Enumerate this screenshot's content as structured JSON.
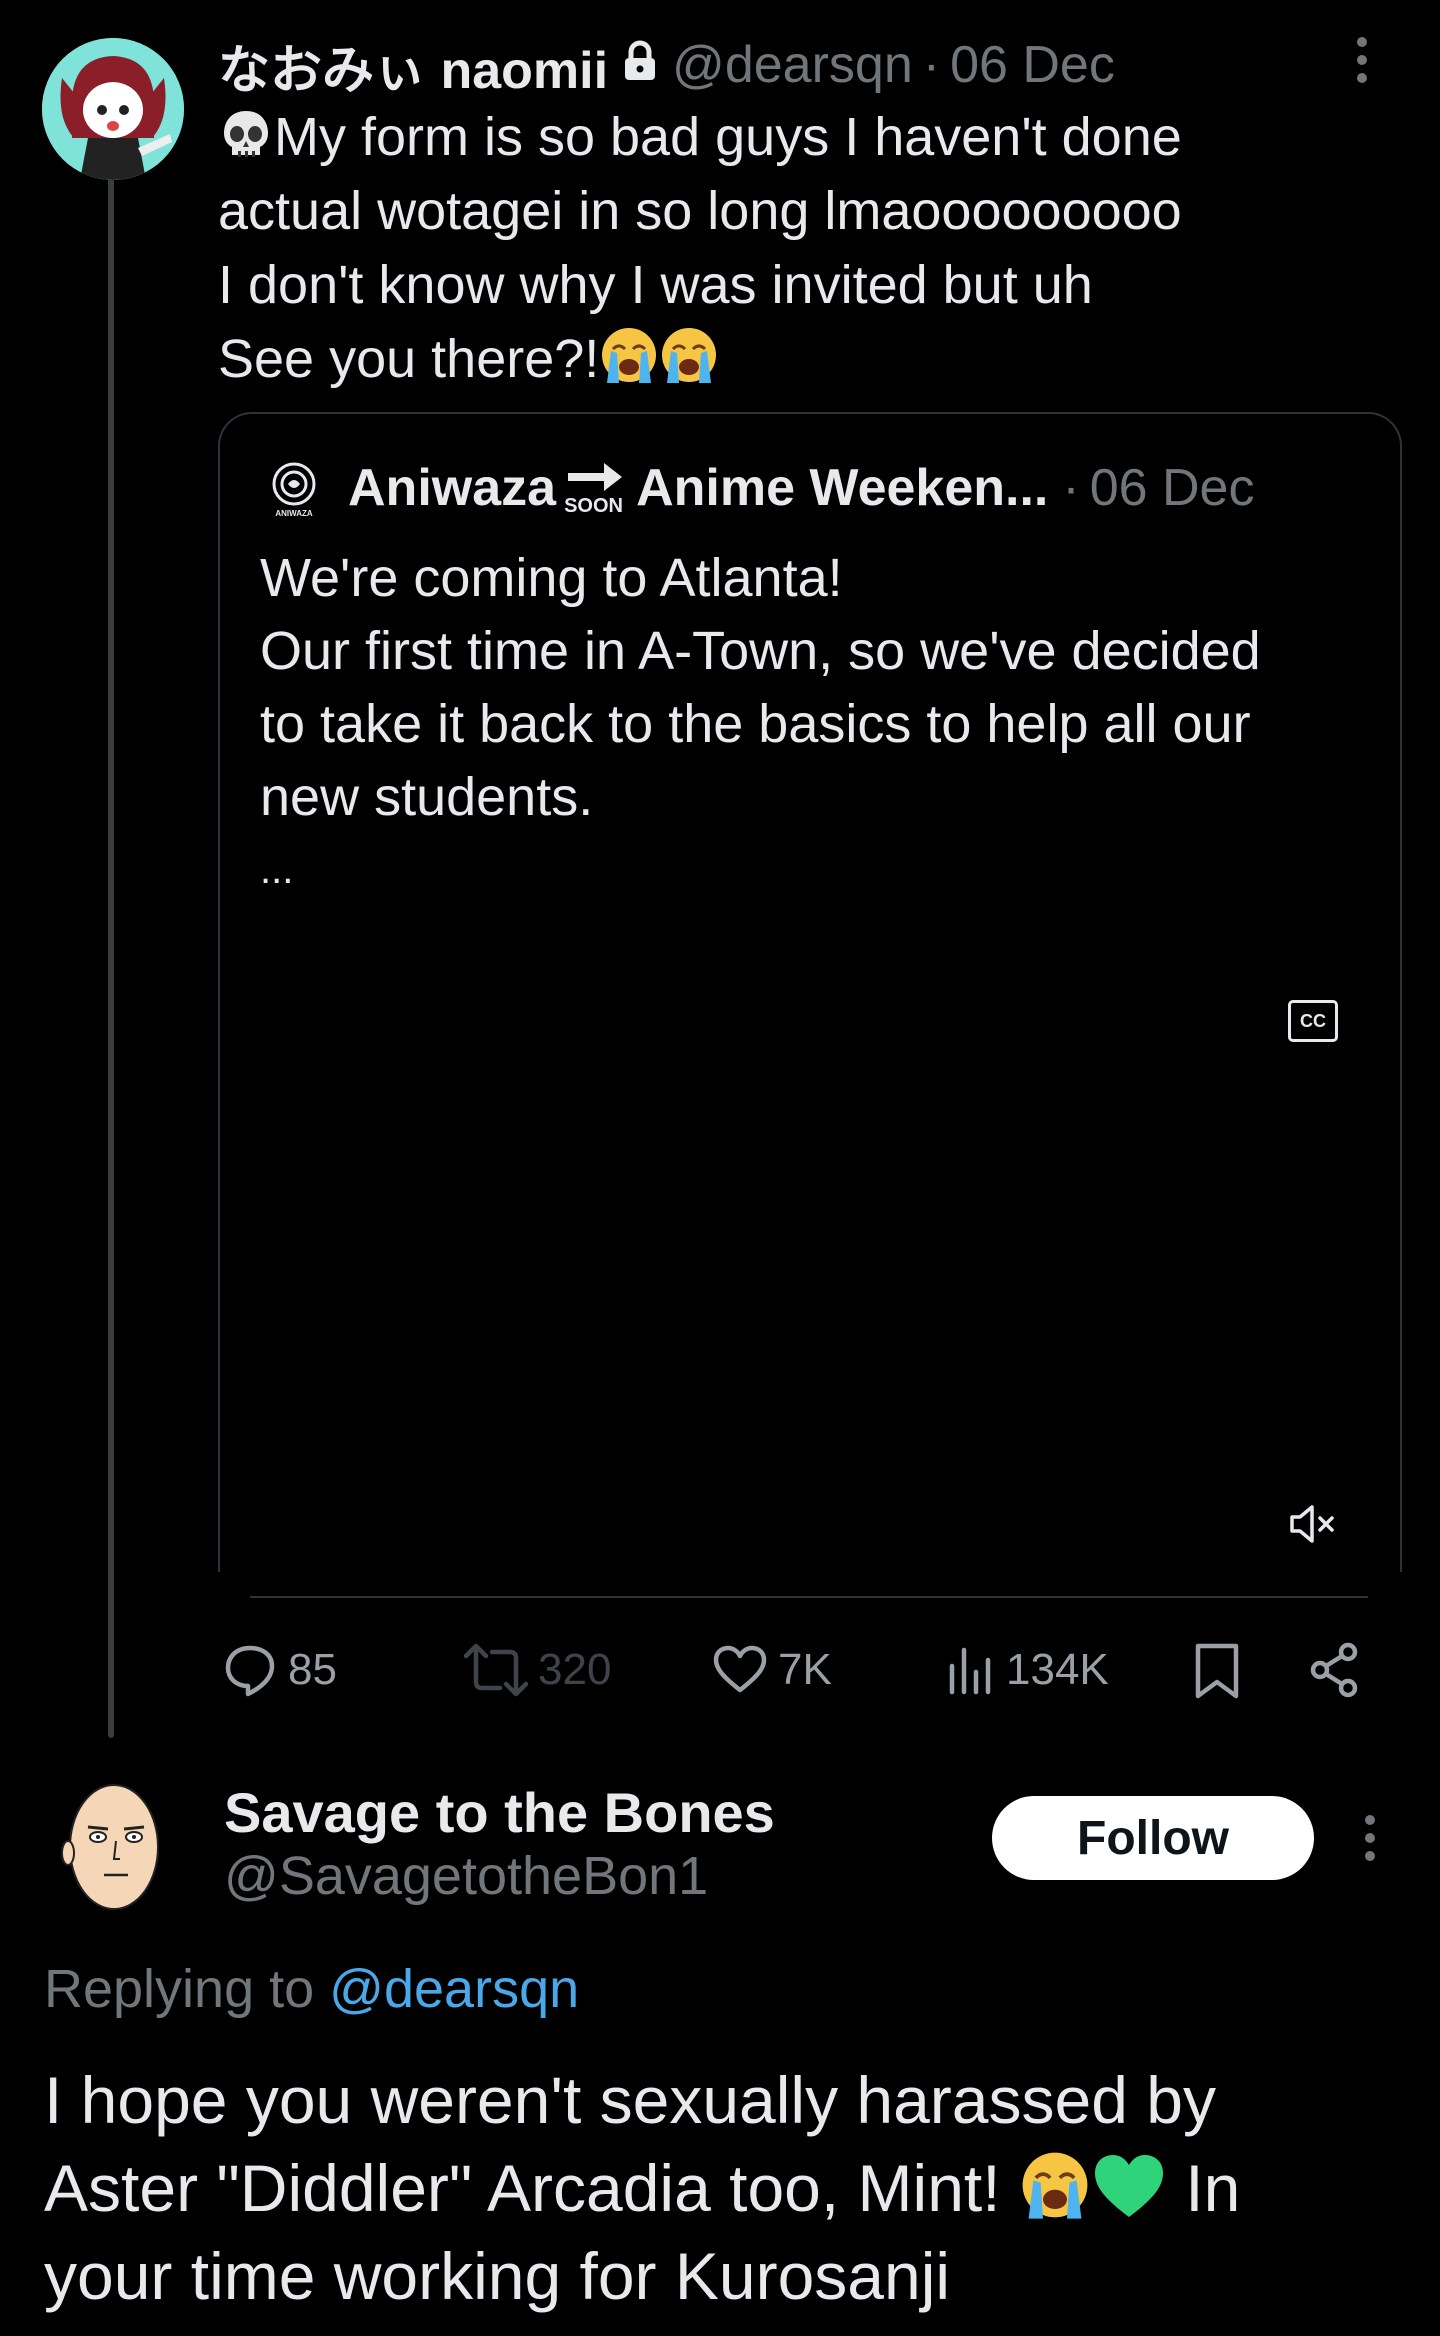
{
  "tweet": {
    "display_name": "なおみぃ naomii",
    "handle": "@dearsqn",
    "separator": "·",
    "date": "06 Dec",
    "text_lines": [
      "My form is so bad guys I haven't done",
      "actual wotagei in so long lmaooooooooo",
      "I don't know why I was invited but uh",
      "See you there?!"
    ],
    "quote": {
      "name_part1": "Aniwaza",
      "soon_badge": "SOON",
      "name_part2": "Anime Weeken...",
      "separator": "·",
      "date": "06 Dec",
      "logo_text": "ANIWAZA",
      "text_lines": [
        "We're coming to Atlanta!",
        "Our first time in A-Town, so we've decided",
        "to take it back to the basics to help all our",
        "new students.",
        "..."
      ],
      "cc_label": "CC"
    },
    "actions": {
      "replies": "85",
      "retweets": "320",
      "likes": "7K",
      "views": "134K"
    }
  },
  "reply": {
    "display_name": "Savage to the Bones",
    "handle": "@SavagetotheBon1",
    "follow_label": "Follow",
    "replying_prefix": "Replying to ",
    "replying_mention": "@dearsqn",
    "text_line1": "I hope you weren't sexually harassed by",
    "text_line2_a": "Aster \"Diddler\" Arcadia too, Mint! ",
    "text_line2_b": " In",
    "text_line3": "your time working for Kurosanji"
  },
  "colors": {
    "background": "#000000",
    "text": "#e7e9ea",
    "muted": "#71767b",
    "link": "#4aa8e8",
    "border": "#2f3336"
  }
}
